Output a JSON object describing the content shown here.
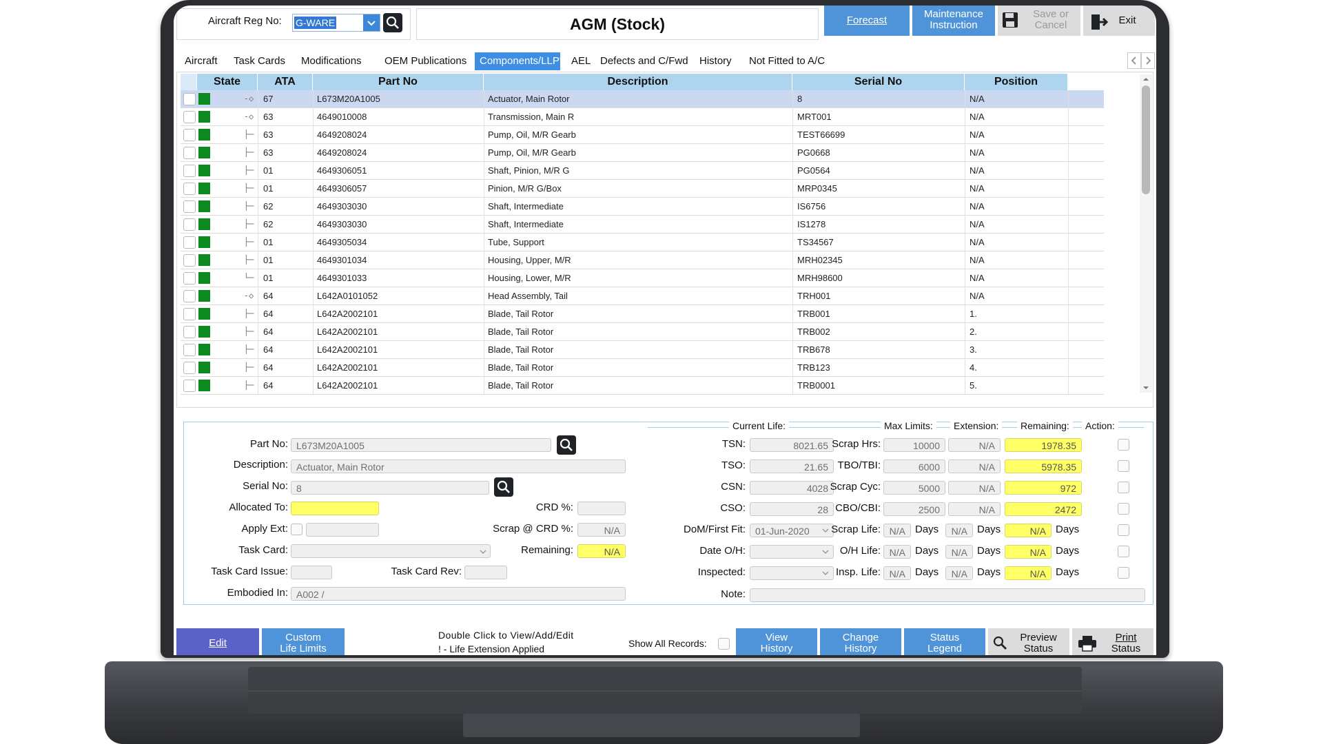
{
  "header": {
    "reg_label": "Aircraft Reg No:",
    "reg_value": "G-WARE",
    "title": "AGM (Stock)",
    "buttons": {
      "forecast": "Forecast",
      "maint_line1": "Maintenance",
      "maint_line2": "Instruction",
      "save_line1": "Save or",
      "save_line2": "Cancel",
      "exit": "Exit"
    }
  },
  "tabs": [
    {
      "label": "Aircraft"
    },
    {
      "label": "Task Cards"
    },
    {
      "label": "Modifications"
    },
    {
      "label": "OEM Publications"
    },
    {
      "label": "Components/LLP's"
    },
    {
      "label": "AEL"
    },
    {
      "label": "Defects and C/Fwd"
    },
    {
      "label": "History"
    },
    {
      "label": "Not Fitted to A/C"
    }
  ],
  "table": {
    "columns": [
      "State",
      "ATA",
      "Part No",
      "Description",
      "Serial No",
      "Position"
    ],
    "rows": [
      {
        "ata": "67",
        "part": "L673M20A1005",
        "desc": "Actuator, Main Rotor",
        "serial": "8",
        "pos": "N/A"
      },
      {
        "ata": "63",
        "part": "4649010008",
        "desc": "Transmission, Main R",
        "serial": "MRT001",
        "pos": "N/A"
      },
      {
        "ata": "63",
        "part": "4649208024",
        "desc": "Pump, Oil, M/R Gearb",
        "serial": "TEST66699",
        "pos": "N/A"
      },
      {
        "ata": "63",
        "part": "4649208024",
        "desc": "Pump, Oil, M/R Gearb",
        "serial": "PG0668",
        "pos": "N/A"
      },
      {
        "ata": "01",
        "part": "4649306051",
        "desc": "Shaft, Pinion, M/R G",
        "serial": "PG0564",
        "pos": "N/A"
      },
      {
        "ata": "01",
        "part": "4649306057",
        "desc": "Pinion, M/R G/Box",
        "serial": "MRP0345",
        "pos": "N/A"
      },
      {
        "ata": "62",
        "part": "4649303030",
        "desc": "Shaft, Intermediate",
        "serial": "IS6756",
        "pos": "N/A"
      },
      {
        "ata": "62",
        "part": "4649303030",
        "desc": "Shaft, Intermediate",
        "serial": "IS1278",
        "pos": "N/A"
      },
      {
        "ata": "01",
        "part": "4649305034",
        "desc": "Tube, Support",
        "serial": "TS34567",
        "pos": "N/A"
      },
      {
        "ata": "01",
        "part": "4649301034",
        "desc": "Housing, Upper, M/R",
        "serial": "MRH02345",
        "pos": "N/A"
      },
      {
        "ata": "01",
        "part": "4649301033",
        "desc": "Housing, Lower, M/R",
        "serial": "MRH98600",
        "pos": "N/A"
      },
      {
        "ata": "64",
        "part": "L642A0101052",
        "desc": "Head Assembly, Tail",
        "serial": "TRH001",
        "pos": "N/A"
      },
      {
        "ata": "64",
        "part": "L642A2002101",
        "desc": "Blade, Tail Rotor",
        "serial": "TRB001",
        "pos": "1."
      },
      {
        "ata": "64",
        "part": "L642A2002101",
        "desc": "Blade, Tail Rotor",
        "serial": "TRB002",
        "pos": "2."
      },
      {
        "ata": "64",
        "part": "L642A2002101",
        "desc": "Blade, Tail Rotor",
        "serial": "TRB678",
        "pos": "3."
      },
      {
        "ata": "64",
        "part": "L642A2002101",
        "desc": "Blade, Tail Rotor",
        "serial": "TRB123",
        "pos": "4."
      },
      {
        "ata": "64",
        "part": "L642A2002101",
        "desc": "Blade, Tail Rotor",
        "serial": "TRB0001",
        "pos": "5."
      }
    ]
  },
  "detail": {
    "labels": {
      "part_no": "Part No:",
      "description": "Description:",
      "serial_no": "Serial No:",
      "allocated_to": "Allocated To:",
      "apply_ext": "Apply Ext:",
      "task_card": "Task Card:",
      "task_card_issue": "Task Card Issue:",
      "task_card_rev": "Task Card Rev:",
      "embodied_in": "Embodied In:",
      "crd_pct": "CRD %:",
      "scrap_crd": "Scrap @ CRD %:",
      "remaining": "Remaining:"
    },
    "values": {
      "part_no": "L673M20A1005",
      "description": "Actuator, Main Rotor",
      "serial_no": "8",
      "allocated_to": "",
      "crd_pct": "",
      "scrap_crd": "N/A",
      "remaining": "N/A",
      "embodied_in": "A002 /"
    }
  },
  "life": {
    "headers": {
      "current": "Current Life:",
      "max": "Max Limits:",
      "extension": "Extension:",
      "remaining": "Remaining:",
      "action": "Action:"
    },
    "days": "Days",
    "note_label": "Note:",
    "rows": [
      {
        "label": "TSN:",
        "current": "8021.65",
        "max_label": "Scrap Hrs:",
        "max": "10000",
        "ext": "N/A",
        "remaining": "1978.35"
      },
      {
        "label": "TSO:",
        "current": "21.65",
        "max_label": "TBO/TBI:",
        "max": "6000",
        "ext": "N/A",
        "remaining": "5978.35"
      },
      {
        "label": "CSN:",
        "current": "4028",
        "max_label": "Scrap Cyc:",
        "max": "5000",
        "ext": "N/A",
        "remaining": "972"
      },
      {
        "label": "CSO:",
        "current": "28",
        "max_label": "CBO/CBI:",
        "max": "2500",
        "ext": "N/A",
        "remaining": "2472"
      },
      {
        "label": "DoM/First Fit:",
        "current": "01-Jun-2020",
        "max_label": "Scrap Life:",
        "max": "N/A",
        "ext": "N/A",
        "remaining": "N/A"
      },
      {
        "label": "Date O/H:",
        "current": "",
        "max_label": "O/H Life:",
        "max": "N/A",
        "ext": "N/A",
        "remaining": "N/A"
      },
      {
        "label": "Inspected:",
        "current": "",
        "max_label": "Insp. Life:",
        "max": "N/A",
        "ext": "N/A",
        "remaining": "N/A"
      }
    ]
  },
  "bottom": {
    "edit": "Edit",
    "custom_line1": "Custom",
    "custom_line2": "Life Limits",
    "hint_line1": "Double Click to View/Add/Edit",
    "hint_line2": "! - Life Extension Applied",
    "show_all": "Show All Records:",
    "view_line1": "View",
    "view_line2": "History",
    "change_line1": "Change",
    "change_line2": "History",
    "status_line1": "Status",
    "status_line2": "Legend",
    "preview_line1": "Preview",
    "preview_line2": "Status",
    "print_line1": "Print",
    "print_line2": "Status"
  },
  "colors": {
    "accent": "#4f94d9",
    "active_tab": "#3e8ee3",
    "header_row": "#aed4ef",
    "state_ok": "#0d8a1f",
    "highlight_yellow": "#ffff66",
    "bottom_edit": "#5a62c8"
  }
}
